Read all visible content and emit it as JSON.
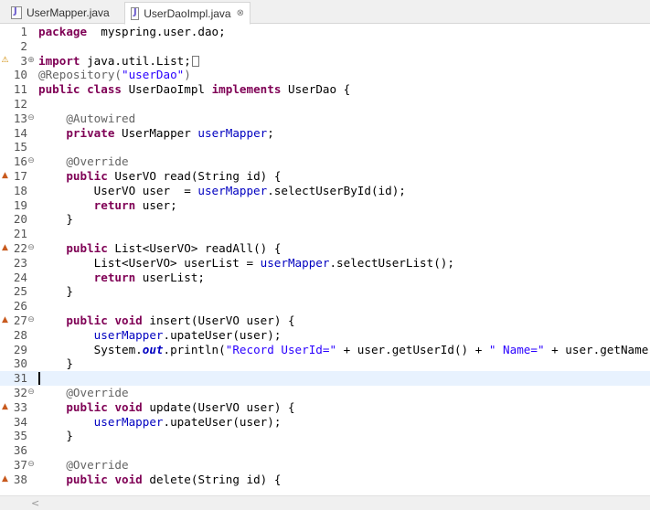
{
  "tabs": [
    {
      "label": "UserMapper.java",
      "active": false
    },
    {
      "label": "UserDaoImpl.java",
      "active": true,
      "close_glyph": "⊗"
    }
  ],
  "editor": {
    "lines": [
      {
        "n": "1",
        "fold": "",
        "marker": "",
        "segs": [
          [
            "kw",
            "package"
          ],
          [
            "",
            "  myspring.user.dao;"
          ]
        ]
      },
      {
        "n": "2",
        "fold": "",
        "marker": "",
        "segs": []
      },
      {
        "n": "3",
        "fold": "⊕",
        "marker": "warn",
        "segs": [
          [
            "kw",
            "import"
          ],
          [
            "",
            " java.util.List;"
          ],
          [
            "box",
            ""
          ]
        ]
      },
      {
        "n": "10",
        "fold": "",
        "marker": "",
        "segs": [
          [
            "ann",
            "@Repository("
          ],
          [
            "str",
            "\"userDao\""
          ],
          [
            "ann",
            ")"
          ]
        ]
      },
      {
        "n": "11",
        "fold": "",
        "marker": "",
        "segs": [
          [
            "kw",
            "public"
          ],
          [
            "",
            " "
          ],
          [
            "kw",
            "class"
          ],
          [
            "",
            " UserDaoImpl "
          ],
          [
            "kw",
            "implements"
          ],
          [
            "",
            " UserDao {"
          ]
        ]
      },
      {
        "n": "12",
        "fold": "",
        "marker": "",
        "segs": []
      },
      {
        "n": "13",
        "fold": "⊖",
        "marker": "",
        "segs": [
          [
            "",
            "    "
          ],
          [
            "ann",
            "@Autowired"
          ]
        ]
      },
      {
        "n": "14",
        "fold": "",
        "marker": "",
        "segs": [
          [
            "",
            "    "
          ],
          [
            "kw",
            "private"
          ],
          [
            "",
            " UserMapper "
          ],
          [
            "fld",
            "userMapper"
          ],
          [
            "",
            ";"
          ]
        ]
      },
      {
        "n": "15",
        "fold": "",
        "marker": "",
        "segs": []
      },
      {
        "n": "16",
        "fold": "⊖",
        "marker": "",
        "segs": [
          [
            "",
            "    "
          ],
          [
            "ann",
            "@Override"
          ]
        ]
      },
      {
        "n": "17",
        "fold": "",
        "marker": "override",
        "segs": [
          [
            "",
            "    "
          ],
          [
            "kw",
            "public"
          ],
          [
            "",
            " UserVO read(String id) {"
          ]
        ]
      },
      {
        "n": "18",
        "fold": "",
        "marker": "",
        "segs": [
          [
            "",
            "        UserVO user  = "
          ],
          [
            "fld",
            "userMapper"
          ],
          [
            "",
            ".selectUserById(id);"
          ]
        ]
      },
      {
        "n": "19",
        "fold": "",
        "marker": "",
        "segs": [
          [
            "",
            "        "
          ],
          [
            "kw",
            "return"
          ],
          [
            "",
            " user;"
          ]
        ]
      },
      {
        "n": "20",
        "fold": "",
        "marker": "",
        "segs": [
          [
            "",
            "    }"
          ]
        ]
      },
      {
        "n": "21",
        "fold": "",
        "marker": "",
        "segs": []
      },
      {
        "n": "22",
        "fold": "⊖",
        "marker": "override",
        "segs": [
          [
            "",
            "    "
          ],
          [
            "kw",
            "public"
          ],
          [
            "",
            " List<UserVO> readAll() {"
          ]
        ]
      },
      {
        "n": "23",
        "fold": "",
        "marker": "",
        "segs": [
          [
            "",
            "        List<UserVO> userList = "
          ],
          [
            "fld",
            "userMapper"
          ],
          [
            "",
            ".selectUserList();"
          ]
        ]
      },
      {
        "n": "24",
        "fold": "",
        "marker": "",
        "segs": [
          [
            "",
            "        "
          ],
          [
            "kw",
            "return"
          ],
          [
            "",
            " userList;"
          ]
        ]
      },
      {
        "n": "25",
        "fold": "",
        "marker": "",
        "segs": [
          [
            "",
            "    }"
          ]
        ]
      },
      {
        "n": "26",
        "fold": "",
        "marker": "",
        "segs": []
      },
      {
        "n": "27",
        "fold": "⊖",
        "marker": "override",
        "segs": [
          [
            "",
            "    "
          ],
          [
            "kw",
            "public"
          ],
          [
            "",
            " "
          ],
          [
            "kw",
            "void"
          ],
          [
            "",
            " insert(UserVO user) {"
          ]
        ]
      },
      {
        "n": "28",
        "fold": "",
        "marker": "",
        "segs": [
          [
            "",
            "        "
          ],
          [
            "fld",
            "userMapper"
          ],
          [
            "",
            ".upateUser(user);"
          ]
        ]
      },
      {
        "n": "29",
        "fold": "",
        "marker": "",
        "segs": [
          [
            "",
            "        System."
          ],
          [
            "sfld",
            "out"
          ],
          [
            "",
            ".println("
          ],
          [
            "str",
            "\"Record UserId=\""
          ],
          [
            "",
            " + user.getUserId() + "
          ],
          [
            "str",
            "\" Name=\""
          ],
          [
            "",
            " + user.getName());"
          ]
        ]
      },
      {
        "n": "30",
        "fold": "",
        "marker": "",
        "segs": [
          [
            "",
            "    }"
          ]
        ]
      },
      {
        "n": "31",
        "fold": "",
        "marker": "",
        "current": true,
        "segs": []
      },
      {
        "n": "32",
        "fold": "⊖",
        "marker": "",
        "segs": [
          [
            "",
            "    "
          ],
          [
            "ann",
            "@Override"
          ]
        ]
      },
      {
        "n": "33",
        "fold": "",
        "marker": "override",
        "segs": [
          [
            "",
            "    "
          ],
          [
            "kw",
            "public"
          ],
          [
            "",
            " "
          ],
          [
            "kw",
            "void"
          ],
          [
            "",
            " update(UserVO user) {"
          ]
        ]
      },
      {
        "n": "34",
        "fold": "",
        "marker": "",
        "segs": [
          [
            "",
            "        "
          ],
          [
            "fld",
            "userMapper"
          ],
          [
            "",
            ".upateUser(user);"
          ]
        ]
      },
      {
        "n": "35",
        "fold": "",
        "marker": "",
        "segs": [
          [
            "",
            "    }"
          ]
        ]
      },
      {
        "n": "36",
        "fold": "",
        "marker": "",
        "segs": []
      },
      {
        "n": "37",
        "fold": "⊖",
        "marker": "",
        "segs": [
          [
            "",
            "    "
          ],
          [
            "ann",
            "@Override"
          ]
        ]
      },
      {
        "n": "38",
        "fold": "",
        "marker": "override",
        "segs": [
          [
            "",
            "    "
          ],
          [
            "kw",
            "public"
          ],
          [
            "",
            " "
          ],
          [
            "kw",
            "void"
          ],
          [
            "",
            " delete(String id) {"
          ]
        ]
      }
    ]
  },
  "scrollbar": {
    "left_arrow": "<"
  },
  "icons": {
    "override_marker": "override-triangle-icon",
    "warn_marker": "warning-icon",
    "fold_expand": "fold-expand-icon",
    "fold_collapse": "fold-collapse-icon"
  },
  "colors": {
    "keyword": "#7f0055",
    "string": "#2a00ff",
    "field": "#0000c0",
    "annotation": "#646464",
    "current_line": "#e8f2fe"
  }
}
